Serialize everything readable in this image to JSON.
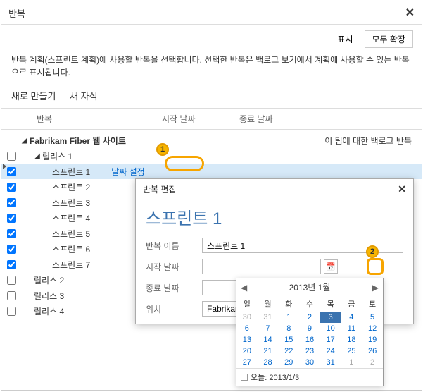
{
  "dialog": {
    "title": "반복",
    "show_btn": "표시",
    "expand_all_btn": "모두 확장",
    "intro": "반복 계획(스프린트 계획)에 사용할 반복을 선택합니다. 선택한 반복은 백로그 보기에서 계획에 사용할 수 있는 반복으로 표시됩니다.",
    "toolbar": {
      "new": "새로 만들기",
      "new_child": "새 자식"
    },
    "columns": {
      "iter": "반복",
      "start": "시작 날짜",
      "end": "종료 날짜"
    },
    "root": {
      "name": "Fabrikam Fiber 웹 사이트",
      "note": "이 팀에 대한 백로그 반복"
    },
    "nodes": [
      {
        "name": "릴리스 1",
        "level": 1,
        "checked": false,
        "expand": true
      },
      {
        "name": "스프린트 1",
        "level": 2,
        "checked": true,
        "sel": true,
        "link": "날짜 설정"
      },
      {
        "name": "스프린트 2",
        "level": 2,
        "checked": true
      },
      {
        "name": "스프린트 3",
        "level": 2,
        "checked": true
      },
      {
        "name": "스프린트 4",
        "level": 2,
        "checked": true
      },
      {
        "name": "스프린트 5",
        "level": 2,
        "checked": true
      },
      {
        "name": "스프린트 6",
        "level": 2,
        "checked": true
      },
      {
        "name": "스프린트 7",
        "level": 2,
        "checked": true
      },
      {
        "name": "릴리스 2",
        "level": 1,
        "checked": false
      },
      {
        "name": "릴리스 3",
        "level": 1,
        "checked": false
      },
      {
        "name": "릴리스 4",
        "level": 1,
        "checked": false
      }
    ]
  },
  "popup": {
    "title": "반복 편집",
    "heading": "스프린트 1",
    "name_label": "반복 이름",
    "name_value": "스프린트 1",
    "start_label": "시작 날짜",
    "start_value": "",
    "end_label": "종료 날짜",
    "end_value": "",
    "loc_label": "위치",
    "loc_value": "Fabrikam Fi..."
  },
  "datepicker": {
    "month": "2013년 1월",
    "dow": [
      "일",
      "월",
      "화",
      "수",
      "목",
      "금",
      "토"
    ],
    "weeks": [
      [
        {
          "d": 30,
          "o": true
        },
        {
          "d": 31,
          "o": true
        },
        {
          "d": 1
        },
        {
          "d": 2
        },
        {
          "d": 3,
          "sel": true
        },
        {
          "d": 4
        },
        {
          "d": 5
        }
      ],
      [
        {
          "d": 6
        },
        {
          "d": 7
        },
        {
          "d": 8
        },
        {
          "d": 9
        },
        {
          "d": 10
        },
        {
          "d": 11
        },
        {
          "d": 12
        }
      ],
      [
        {
          "d": 13
        },
        {
          "d": 14
        },
        {
          "d": 15
        },
        {
          "d": 16
        },
        {
          "d": 17
        },
        {
          "d": 18
        },
        {
          "d": 19
        }
      ],
      [
        {
          "d": 20
        },
        {
          "d": 21
        },
        {
          "d": 22
        },
        {
          "d": 23
        },
        {
          "d": 24
        },
        {
          "d": 25
        },
        {
          "d": 26
        }
      ],
      [
        {
          "d": 27
        },
        {
          "d": 28
        },
        {
          "d": 29
        },
        {
          "d": 30
        },
        {
          "d": 31
        },
        {
          "d": 1,
          "o": true
        },
        {
          "d": 2,
          "o": true
        }
      ]
    ],
    "today_label": "오늘: 2013/1/3"
  },
  "callouts": {
    "c1": "1",
    "c2": "2"
  }
}
